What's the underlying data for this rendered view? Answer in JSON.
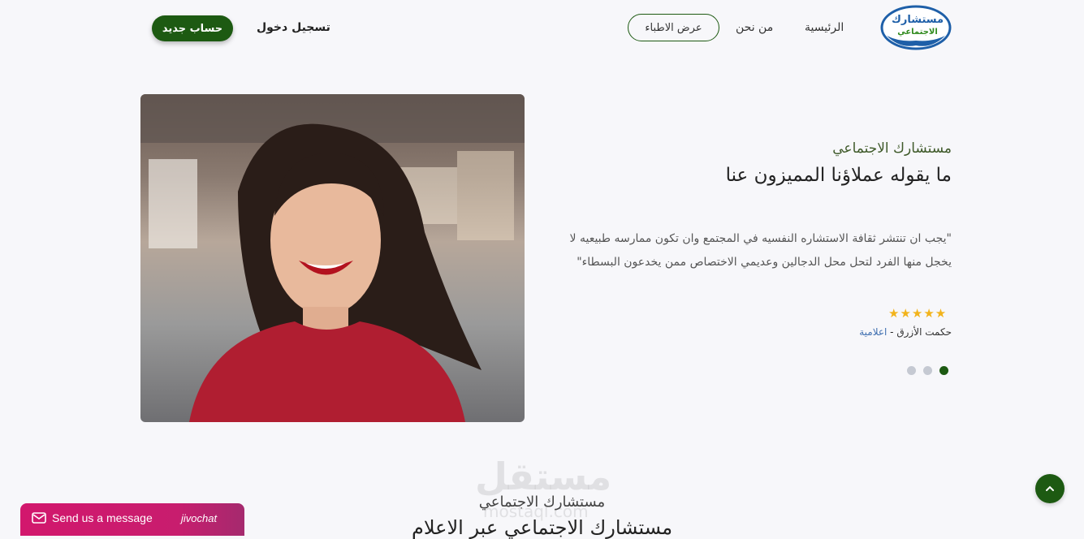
{
  "nav": {
    "logo_line1": "مستشارك",
    "logo_line2": "الاجتماعي",
    "home": "الرئيسية",
    "about": "من نحن",
    "doctors": "عرض الاطباء",
    "login": "تسجيل دخول",
    "register": "حساب جديد"
  },
  "testimonial": {
    "eyebrow": "مستشارك الاجتماعي",
    "title": "ما يقوله عملاؤنا المميزون عنا",
    "quote": "\"يجب ان تنتشر ثقافة الاستشاره النفسيه في المجتمع وان تكون ممارسه طبيعيه لا يخجل منها الفرد لتحل محل الدجالين وعديمي الاختصاص ممن يخدعون البسطاء\"",
    "rating": 5,
    "stars": "★★★★★",
    "author_name": "حكمت الأزرق",
    "author_separator": " - ",
    "author_role": "اعلامية",
    "slides_count": 3,
    "active_slide": 1
  },
  "section2": {
    "eyebrow": "مستشارك الاجتماعي",
    "title": "مستشارك الاجتماعي عبر الاعلام"
  },
  "watermark": {
    "text": "مستقل",
    "sub": "mostaql.com"
  },
  "chat": {
    "label": "Send us a message",
    "brand": "jivochat"
  },
  "colors": {
    "brand_green": "#1d5a12",
    "star": "#f2b31b",
    "chat_pink": "#d2176d"
  }
}
